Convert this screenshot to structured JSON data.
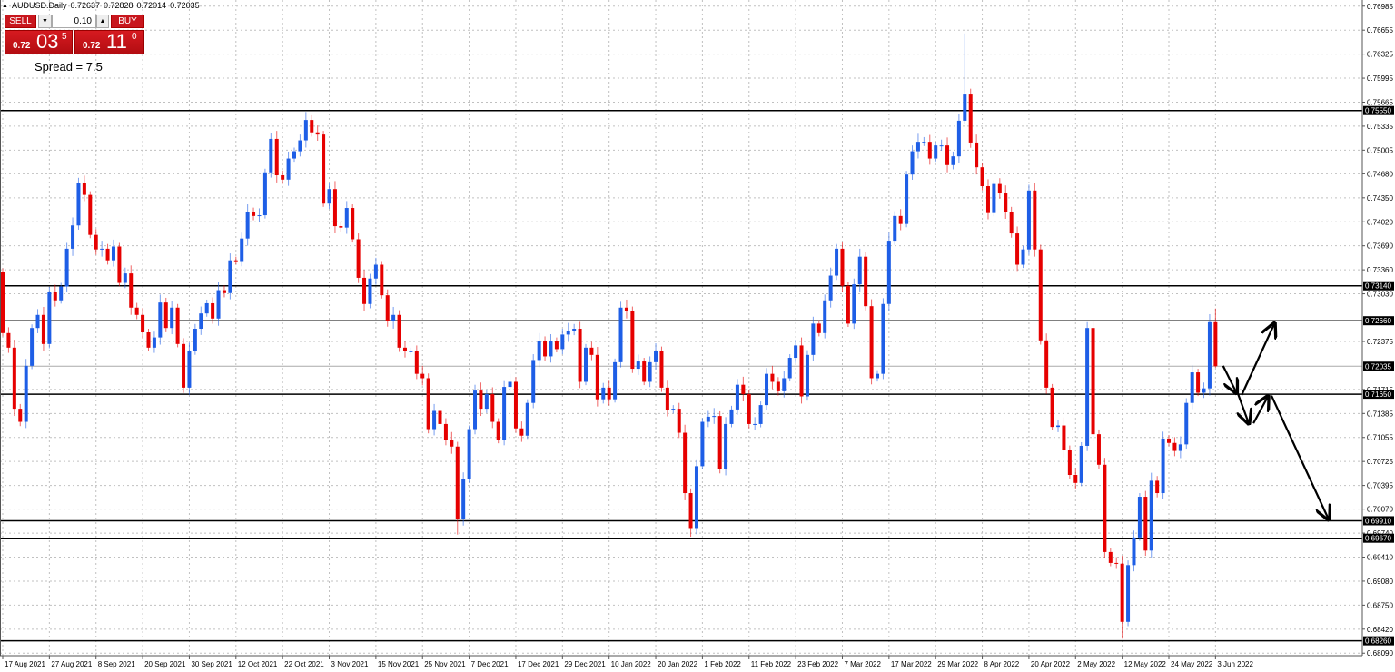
{
  "header": {
    "symbol": "AUDUSD.Daily",
    "open": "0.72637",
    "high": "0.72828",
    "low": "0.72014",
    "close": "0.72035"
  },
  "trade_panel": {
    "sell_label": "SELL",
    "buy_label": "BUY",
    "lot": "0.10",
    "sell_price": {
      "prefix": "0.72",
      "big": "03",
      "sup": "5"
    },
    "buy_price": {
      "prefix": "0.72",
      "big": "11",
      "sup": "0"
    },
    "spread": "Spread = 7.5"
  },
  "colors": {
    "bull": "#1e5ee6",
    "bear": "#e60000",
    "grid": "#c0c0c0",
    "level": "#000000",
    "panel_red": "#c8161d"
  },
  "chart_data": {
    "type": "candlestick",
    "title": "AUDUSD.Daily",
    "first_open": 0.7333,
    "closes": [
      0.7249,
      0.7229,
      0.7145,
      0.7127,
      0.7204,
      0.7256,
      0.7274,
      0.7234,
      0.7306,
      0.7294,
      0.7313,
      0.7365,
      0.7397,
      0.7456,
      0.7439,
      0.7384,
      0.7364,
      0.7365,
      0.7349,
      0.7368,
      0.7318,
      0.7331,
      0.7284,
      0.7274,
      0.725,
      0.7229,
      0.7243,
      0.7291,
      0.7256,
      0.7284,
      0.7234,
      0.7174,
      0.7225,
      0.7255,
      0.7276,
      0.729,
      0.7269,
      0.7308,
      0.7304,
      0.7349,
      0.7348,
      0.7379,
      0.7415,
      0.741,
      0.7411,
      0.747,
      0.7516,
      0.7466,
      0.746,
      0.7489,
      0.7499,
      0.7514,
      0.7542,
      0.7525,
      0.7522,
      0.7427,
      0.7447,
      0.7396,
      0.7394,
      0.7421,
      0.7378,
      0.7325,
      0.7289,
      0.7324,
      0.7343,
      0.7301,
      0.7265,
      0.7274,
      0.7229,
      0.7224,
      0.7224,
      0.7193,
      0.7187,
      0.7117,
      0.7142,
      0.7124,
      0.7102,
      0.7093,
      0.6993,
      0.7048,
      0.7117,
      0.717,
      0.7145,
      0.7165,
      0.7127,
      0.7102,
      0.7175,
      0.7182,
      0.7118,
      0.7108,
      0.7153,
      0.7212,
      0.7238,
      0.7217,
      0.7238,
      0.7227,
      0.7247,
      0.7252,
      0.7255,
      0.7182,
      0.7229,
      0.7219,
      0.7158,
      0.7174,
      0.7158,
      0.7209,
      0.7284,
      0.7279,
      0.72,
      0.721,
      0.7182,
      0.7209,
      0.7224,
      0.7174,
      0.7143,
      0.7145,
      0.7112,
      0.7029,
      0.6981,
      0.7066,
      0.7127,
      0.7134,
      0.7135,
      0.7062,
      0.7124,
      0.7144,
      0.7178,
      0.7165,
      0.7124,
      0.7124,
      0.715,
      0.7193,
      0.7182,
      0.7169,
      0.7187,
      0.7215,
      0.7232,
      0.7162,
      0.7219,
      0.7262,
      0.7249,
      0.7294,
      0.7328,
      0.7365,
      0.7314,
      0.7262,
      0.7316,
      0.7354,
      0.7286,
      0.7187,
      0.7193,
      0.7289,
      0.7376,
      0.741,
      0.7399,
      0.7467,
      0.7499,
      0.7512,
      0.7512,
      0.7489,
      0.7507,
      0.7507,
      0.748,
      0.7492,
      0.7541,
      0.7577,
      0.7511,
      0.7477,
      0.7451,
      0.7414,
      0.7454,
      0.7441,
      0.7416,
      0.7386,
      0.7343,
      0.7364,
      0.7445,
      0.7364,
      0.7239,
      0.7174,
      0.712,
      0.7122,
      0.7088,
      0.7054,
      0.7043,
      0.7094,
      0.7256,
      0.711,
      0.7068,
      0.6948,
      0.6933,
      0.6932,
      0.6852,
      0.693,
      0.6968,
      0.7024,
      0.695,
      0.7046,
      0.7029,
      0.7104,
      0.7098,
      0.7087,
      0.7096,
      0.7153,
      0.7195,
      0.7167,
      0.7173,
      0.7264,
      0.72035
    ],
    "extreme_overrides": {
      "165": {
        "high": 0.7661
      },
      "192": {
        "low": 0.6829
      },
      "208": {
        "high": 0.72828,
        "low": 0.72014
      },
      "78": {
        "low": 0.6972
      },
      "118": {
        "low": 0.6969
      }
    },
    "levels": [
      "0.75550",
      "0.73140",
      "0.72660",
      "0.71650",
      "0.69910",
      "0.69670",
      "0.68260"
    ],
    "current_price": "0.72035",
    "price_ticks": [
      "0.76985",
      "0.76655",
      "0.76325",
      "0.75995",
      "0.75665",
      "0.75335",
      "0.75005",
      "0.74680",
      "0.74350",
      "0.74020",
      "0.73690",
      "0.73360",
      "0.73030",
      "0.72375",
      "0.71715",
      "0.71385",
      "0.71055",
      "0.70725",
      "0.70395",
      "0.70070",
      "0.69740",
      "0.69410",
      "0.69080",
      "0.68750",
      "0.68420",
      "0.68090"
    ],
    "date_labels": [
      "17 Aug 2021",
      "27 Aug 2021",
      "8 Sep 2021",
      "20 Sep 2021",
      "30 Sep 2021",
      "12 Oct 2021",
      "22 Oct 2021",
      "3 Nov 2021",
      "15 Nov 2021",
      "25 Nov 2021",
      "7 Dec 2021",
      "17 Dec 2021",
      "29 Dec 2021",
      "10 Jan 2022",
      "20 Jan 2022",
      "1 Feb 2022",
      "11 Feb 2022",
      "23 Feb 2022",
      "7 Mar 2022",
      "17 Mar 2022",
      "29 Mar 2022",
      "8 Apr 2022",
      "20 Apr 2022",
      "2 May 2022",
      "12 May 2022",
      "24 May 2022",
      "3 Jun 2022"
    ],
    "bars_per_date_label": 8,
    "arrows": [
      {
        "from": [
          209.3,
          0.7204
        ],
        "to": [
          211.6,
          0.7167
        ]
      },
      {
        "from": [
          211.6,
          0.7171
        ],
        "to": [
          213.7,
          0.7125
        ]
      },
      {
        "from": [
          212.5,
          0.7164
        ],
        "to": [
          218.1,
          0.7262
        ]
      },
      {
        "from": [
          214.5,
          0.7125
        ],
        "to": [
          217.0,
          0.7162
        ]
      },
      {
        "from": [
          217.6,
          0.7163
        ],
        "to": [
          227.4,
          0.6993
        ]
      }
    ]
  }
}
